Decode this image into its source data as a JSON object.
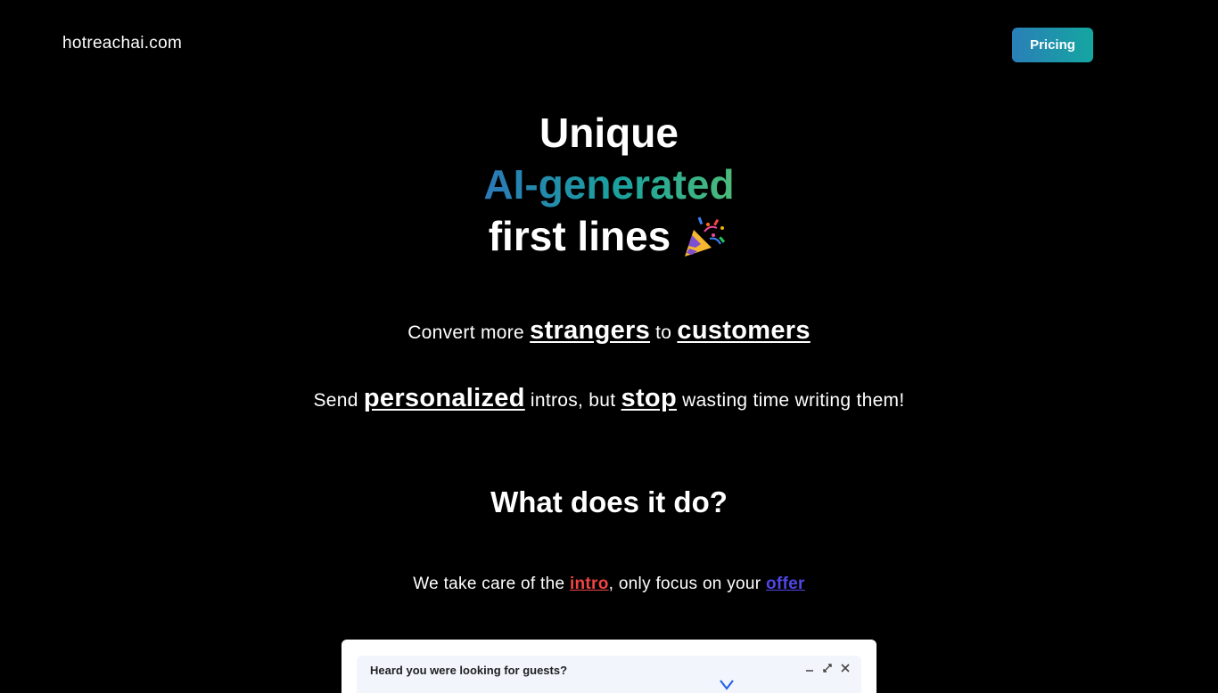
{
  "header": {
    "brand": "hotreachai.com",
    "pricing_label": "Pricing"
  },
  "hero": {
    "line1": "Unique",
    "line2": "AI-generated",
    "line3": "first lines",
    "line3_icon": "party-popper-icon"
  },
  "tagline1": {
    "pre": "Convert more ",
    "word1": "strangers",
    "mid": " to ",
    "word2": "customers"
  },
  "tagline2": {
    "pre": "Send ",
    "word1": "personalized",
    "mid": " intros, but ",
    "word2": "stop",
    "post": " wasting time writing them!"
  },
  "section": {
    "title": "What does it do?"
  },
  "focus": {
    "pre": "We take care of the ",
    "link1": "intro",
    "mid": ", only focus on your ",
    "link2": "offer"
  },
  "email_preview": {
    "subject": "Heard you were looking for guests?",
    "controls": [
      "minimize-icon",
      "expand-icon",
      "close-icon"
    ]
  },
  "colors": {
    "background": "#000000",
    "accent_blue": "#2a7fb8",
    "accent_teal": "#14a6a0",
    "link_red": "#ef4444",
    "link_blue": "#4f46e5"
  }
}
